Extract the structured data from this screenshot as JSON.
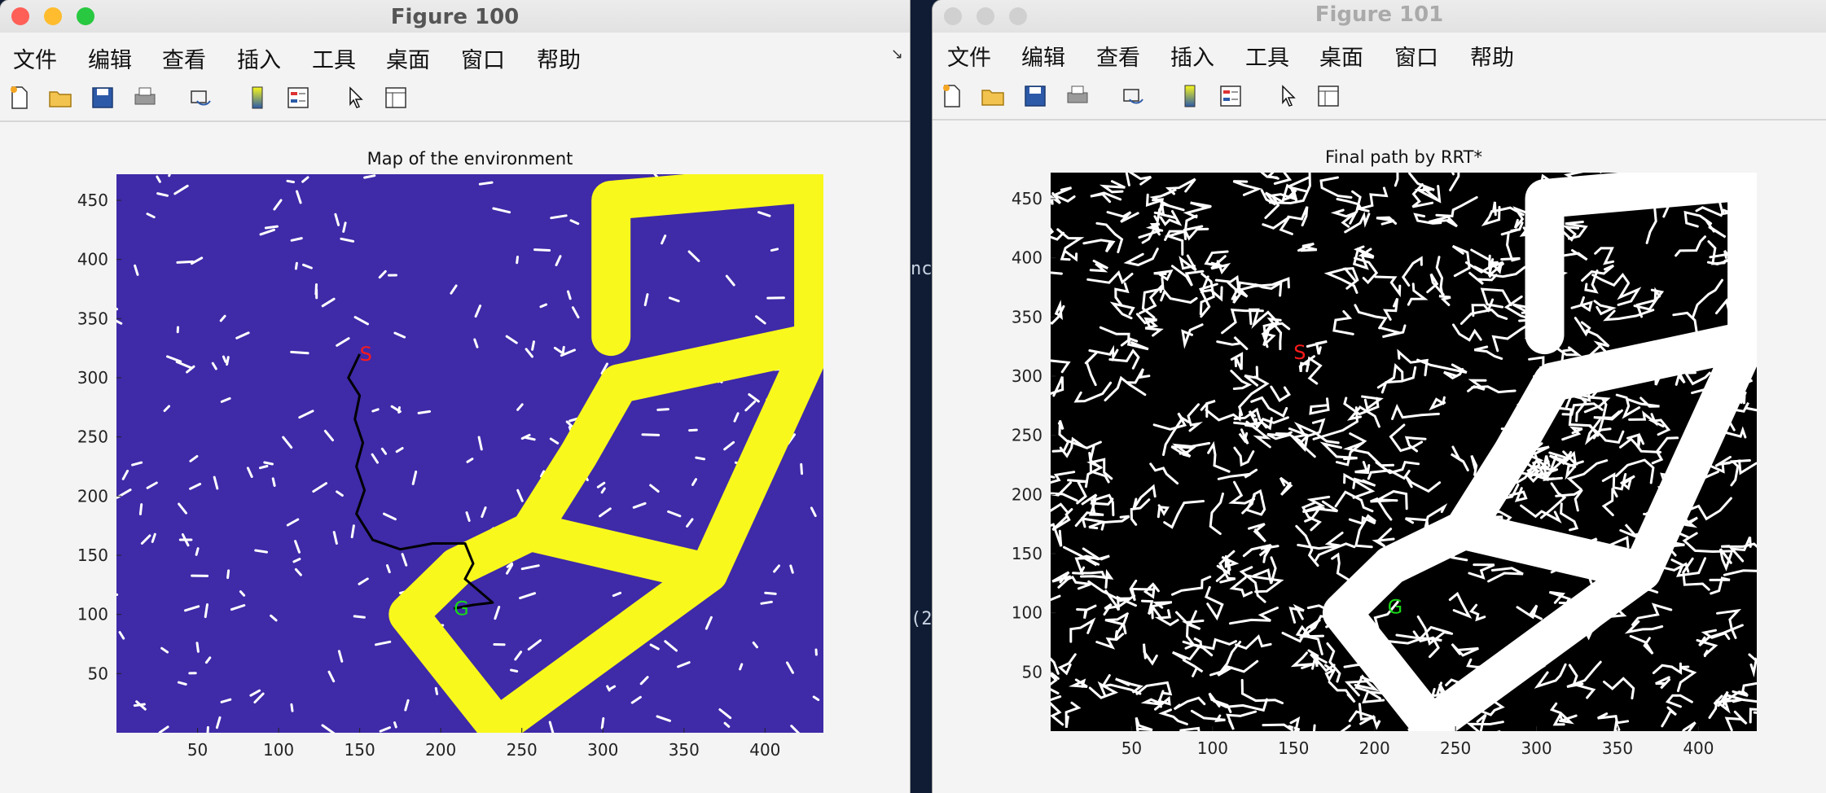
{
  "backdrop": {
    "text_a": "nc",
    "text_b": "(2"
  },
  "windows": [
    {
      "id": "win1",
      "title": "Figure 100",
      "active": true,
      "menu": [
        "文件",
        "编辑",
        "查看",
        "插入",
        "工具",
        "桌面",
        "窗口",
        "帮助"
      ],
      "menu_arrow": "↘",
      "toolbar": [
        "new-file-icon",
        "open-folder-icon",
        "save-icon",
        "print-icon",
        "link-icon",
        "colorbar-icon",
        "legend-icon",
        "cursor-icon",
        "property-panel-icon"
      ],
      "plot": {
        "title": "Map of the environment",
        "background": "#3f2aa8",
        "obstacle_color": "#f8f81c",
        "path_color": "#000000",
        "start_label": "S",
        "goal_label": "G",
        "start_color": "#ff1a1a",
        "goal_color": "#18d818"
      }
    },
    {
      "id": "win2",
      "title": "Figure 101",
      "active": false,
      "menu": [
        "文件",
        "编辑",
        "查看",
        "插入",
        "工具",
        "桌面",
        "窗口",
        "帮助"
      ],
      "toolbar": [
        "new-file-icon",
        "open-folder-icon",
        "save-icon",
        "print-icon",
        "link-icon",
        "colorbar-icon",
        "legend-icon",
        "cursor-icon",
        "property-panel-icon"
      ],
      "plot": {
        "title": "Final path by RRT*",
        "background": "#000000",
        "obstacle_color": "#ffffff",
        "start_label": "S",
        "goal_label": "G",
        "start_color": "#ff1a1a",
        "goal_color": "#18d818"
      }
    }
  ],
  "chart_data": [
    {
      "type": "image-map",
      "title": "Map of the environment",
      "xlim": [
        0,
        436
      ],
      "ylim": [
        0,
        472
      ],
      "xticks": [
        50,
        100,
        150,
        200,
        250,
        300,
        350,
        400
      ],
      "yticks": [
        50,
        100,
        150,
        200,
        250,
        300,
        350,
        400,
        450
      ],
      "start": {
        "label": "S",
        "x": 150,
        "y": 320
      },
      "goal": {
        "label": "G",
        "x": 208,
        "y": 105
      },
      "path": [
        [
          150,
          320
        ],
        [
          143,
          300
        ],
        [
          150,
          285
        ],
        [
          147,
          265
        ],
        [
          152,
          245
        ],
        [
          148,
          225
        ],
        [
          153,
          205
        ],
        [
          148,
          185
        ],
        [
          158,
          163
        ],
        [
          175,
          155
        ],
        [
          195,
          160
        ],
        [
          215,
          160
        ],
        [
          220,
          143
        ],
        [
          215,
          130
        ],
        [
          232,
          110
        ],
        [
          220,
          108
        ],
        [
          208,
          105
        ]
      ],
      "obstacle": [
        [
          235,
          5
        ],
        [
          180,
          100
        ],
        [
          210,
          140
        ],
        [
          255,
          170
        ],
        [
          285,
          235
        ],
        [
          310,
          295
        ],
        [
          305,
          335
        ],
        [
          305,
          450
        ],
        [
          430,
          465
        ],
        [
          430,
          330
        ],
        [
          365,
          135
        ]
      ]
    },
    {
      "type": "image-map",
      "title": "Final path by RRT*",
      "xlim": [
        0,
        436
      ],
      "ylim": [
        0,
        472
      ],
      "xticks": [
        50,
        100,
        150,
        200,
        250,
        300,
        350,
        400
      ],
      "yticks": [
        50,
        100,
        150,
        200,
        250,
        300,
        350,
        400,
        450
      ],
      "start": {
        "label": "S",
        "x": 150,
        "y": 320
      },
      "goal": {
        "label": "G",
        "x": 208,
        "y": 105
      },
      "obstacle": [
        [
          235,
          5
        ],
        [
          180,
          100
        ],
        [
          210,
          140
        ],
        [
          255,
          170
        ],
        [
          285,
          235
        ],
        [
          310,
          295
        ],
        [
          305,
          335
        ],
        [
          305,
          450
        ],
        [
          430,
          465
        ],
        [
          430,
          330
        ],
        [
          365,
          135
        ]
      ]
    }
  ]
}
